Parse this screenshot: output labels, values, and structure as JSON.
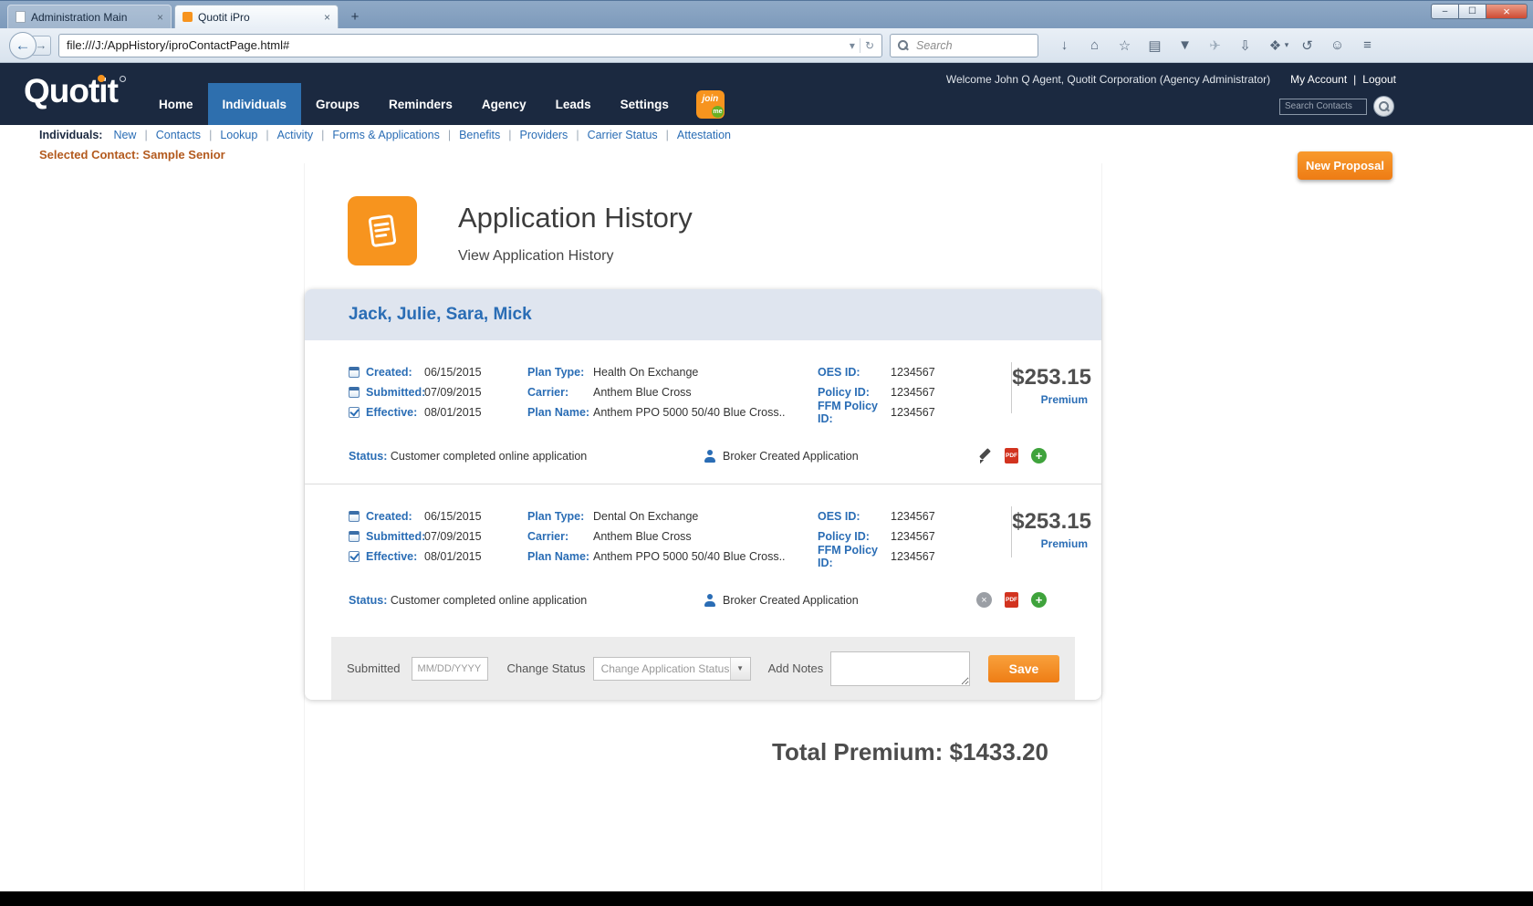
{
  "icons": {
    "back": "←",
    "forward": "→",
    "url_dropdown": "▾",
    "reload": "↻",
    "download": "↓",
    "home": "⌂",
    "bookmark_star": "☆",
    "reading_list": "▤",
    "pocket": "▼",
    "send": "✈",
    "save_page": "⇩",
    "addons": "❖",
    "history": "↺",
    "chat": "☺",
    "menu": "≡",
    "minimize": "–",
    "maximize": "☐",
    "close": "×",
    "tab_close": "×",
    "new_tab": "+",
    "pdf": "PDF",
    "add": "+",
    "remove": "×",
    "select_arrow": "▼"
  },
  "browser": {
    "tabs": [
      "Administration Main",
      "Quotit iPro"
    ],
    "url": "file:///J:/AppHistory/iproContactPage.html#",
    "search_placeholder": "Search"
  },
  "site": {
    "logo": "Quotit",
    "welcome": "Welcome John Q Agent, Quotit Corporation (Agency Administrator)",
    "my_account": "My Account",
    "logout": "Logout",
    "link_separator": "|",
    "nav": [
      "Home",
      "Individuals",
      "Groups",
      "Reminders",
      "Agency",
      "Leads",
      "Settings"
    ],
    "joinme_join": "join",
    "joinme_me": "me",
    "search_contacts_placeholder": "Search Contacts",
    "subnav_label": "Individuals:",
    "subnav_items": [
      "New",
      "Contacts",
      "Lookup",
      "Activity",
      "Forms & Applications",
      "Benefits",
      "Providers",
      "Carrier Status",
      "Attestation"
    ],
    "selected_contact": "Selected Contact: Sample Senior",
    "new_proposal": "New Proposal"
  },
  "page": {
    "title": "Application History",
    "subtitle": "View Application History",
    "total_premium": "Total Premium: $1433.20"
  },
  "labels": {
    "created": "Created:",
    "submitted": "Submitted:",
    "effective": "Effective:",
    "plan_type": "Plan Type:",
    "carrier": "Carrier:",
    "plan_name": "Plan Name:",
    "oes_id": "OES ID:",
    "policy_id": "Policy ID:",
    "ffm_policy_id": "FFM Policy ID:",
    "premium": "Premium",
    "status": "Status:"
  },
  "card": {
    "group_name": "Jack, Julie, Sara, Mick",
    "applications": [
      {
        "created": "06/15/2015",
        "submitted": "07/09/2015",
        "effective": "08/01/2015",
        "plan_type": "Health On Exchange",
        "carrier": "Anthem Blue Cross",
        "plan_name": "Anthem PPO 5000 50/40 Blue Cross..",
        "oes_id": "1234567",
        "policy_id": "1234567",
        "ffm_policy_id": "1234567",
        "premium": "$253.15",
        "status": "Customer completed online application",
        "broker_note": "Broker Created Application"
      },
      {
        "created": "06/15/2015",
        "submitted": "07/09/2015",
        "effective": "08/01/2015",
        "plan_type": "Dental On Exchange",
        "carrier": "Anthem Blue Cross",
        "plan_name": "Anthem PPO 5000 50/40 Blue Cross..",
        "oes_id": "1234567",
        "policy_id": "1234567",
        "ffm_policy_id": "1234567",
        "premium": "$253.15",
        "status": "Customer completed online application",
        "broker_note": "Broker Created Application"
      }
    ]
  },
  "form": {
    "submitted_label": "Submitted",
    "date_placeholder": "MM/DD/YYYY",
    "change_status_label": "Change Status",
    "change_status_value": "Change Application Status",
    "add_notes_label": "Add Notes",
    "save_label": "Save"
  }
}
